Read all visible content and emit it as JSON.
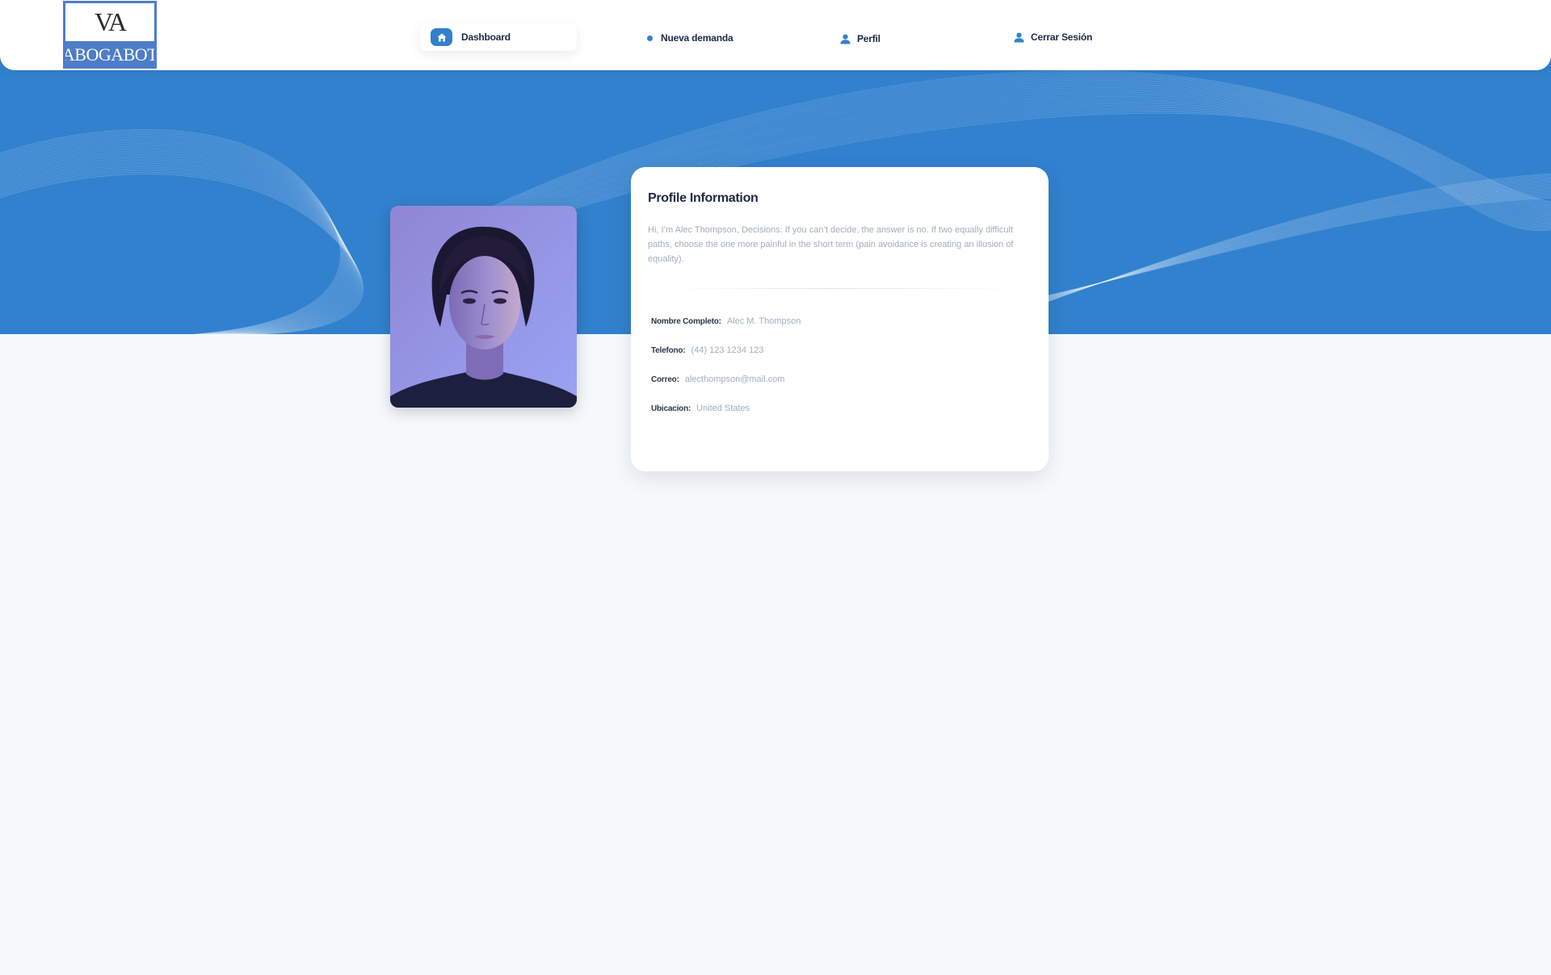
{
  "brand": {
    "logo_top": "VA",
    "logo_bottom": "ABOGABOT"
  },
  "nav": {
    "items": [
      {
        "label": "Dashboard",
        "icon": "home-icon",
        "active": true
      },
      {
        "label": "Nueva demanda",
        "icon": "dot-icon"
      },
      {
        "label": "Perfil",
        "icon": "person-icon"
      },
      {
        "label": "Cerrar Sesión",
        "icon": "person-icon"
      }
    ]
  },
  "profile": {
    "title": "Profile Information",
    "bio": "Hi, I’m Alec Thompson, Decisions: If you can’t decide, the answer is no. If two equally difficult paths, choose the one more painful in the short term (pain avoidance is creating an illusion of equality).",
    "fields": [
      {
        "label": "Nombre Completo:",
        "value": "Alec M. Thompson"
      },
      {
        "label": "Telefono:",
        "value": "(44) 123 1234 123"
      },
      {
        "label": "Correo:",
        "value": "alecthompson@mail.com"
      },
      {
        "label": "Ubicacion:",
        "value": "United States"
      }
    ]
  },
  "colors": {
    "primary": "#3181ce",
    "background": "#f6f9fc",
    "logo_blue": "#4e7dc8",
    "text_dark": "#1d2a44",
    "text_muted": "#a0aec0"
  }
}
